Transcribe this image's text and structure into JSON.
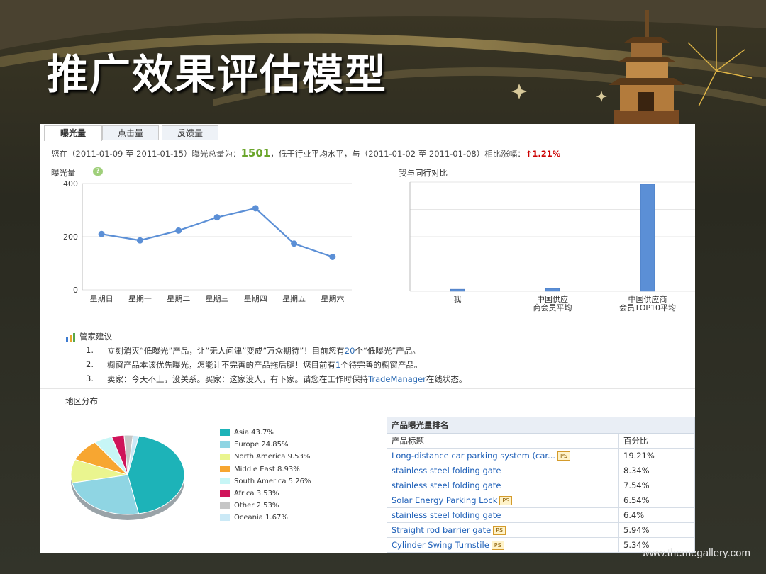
{
  "slide": {
    "title": "推广效果评估模型",
    "footer": "www.themegallery.com"
  },
  "tabs": [
    {
      "label": "曝光量",
      "active": true
    },
    {
      "label": "点击量",
      "active": false
    },
    {
      "label": "反馈量",
      "active": false
    }
  ],
  "summary": {
    "prefix": "您在（2011-01-09 至 2011-01-15）曝光总量为：",
    "total": "1501",
    "middle": "，低于行业平均水平，与（2011-01-02 至 2011-01-08）相比涨幅：",
    "change": "↑1.21%"
  },
  "exposure_chart": {
    "title": "曝光量",
    "help_icon": "?"
  },
  "compare_chart": {
    "title": "我与同行对比"
  },
  "chart_data": [
    {
      "type": "line",
      "title": "曝光量",
      "categories": [
        "星期日",
        "星期一",
        "星期二",
        "星期三",
        "星期四",
        "星期五",
        "星期六"
      ],
      "values": [
        210,
        186,
        223,
        273,
        307,
        174,
        124
      ],
      "ylim": [
        0,
        400
      ],
      "yticks": [
        "0",
        "200",
        "400"
      ],
      "color": "#5b8fd6",
      "grid": true
    },
    {
      "type": "bar",
      "title": "我与同行对比",
      "categories": [
        "我",
        "中国供应商会员平均",
        "中国供应商会员TOP10平均"
      ],
      "category_lines": [
        [
          "我"
        ],
        [
          "中国供应",
          "商会员平均"
        ],
        [
          "中国供应商",
          "会员TOP10平均"
        ]
      ],
      "values": [
        1501,
        2100,
        78500
      ],
      "ylim": [
        0,
        80000
      ],
      "color": "#5b8fd6",
      "grid": true
    },
    {
      "type": "pie",
      "title": "地区分布",
      "labels": [
        "Asia 43.7%",
        "Europe 24.85%",
        "North America 9.53%",
        "Middle East 8.93%",
        "South America 5.26%",
        "Africa 3.53%",
        "Other 2.53%",
        "Oceania 1.67%"
      ],
      "values": [
        43.7,
        24.85,
        9.53,
        8.93,
        5.26,
        3.53,
        2.53,
        1.67
      ],
      "colors": [
        "#1db3b8",
        "#8fd5e3",
        "#eaf58f",
        "#f7a631",
        "#c7f6f6",
        "#cf145a",
        "#c6c6c6",
        "#cbe9f6"
      ]
    }
  ],
  "advice": {
    "title": "管家建议",
    "items": [
      {
        "num": "1.",
        "pre": "立刻消灭“低曝光”产品，让“无人问津”变成“万众期待”！目前您有",
        "hl": "20",
        "post": "个“低曝光”产品。"
      },
      {
        "num": "2.",
        "pre": "橱窗产品本该优先曝光，怎能让不完善的产品拖后腿！您目前有",
        "hl": "1",
        "post": "个待完善的橱窗产品。"
      },
      {
        "num": "3.",
        "pre": "卖家：今天不上，没关系。买家：这家没人，有下家。请您在工作时保持",
        "hl": "TradeManager",
        "post": "在线状态。"
      }
    ]
  },
  "region": {
    "title": "地区分布"
  },
  "ranking": {
    "caption": "产品曝光量排名",
    "headers": [
      "产品标题",
      "百分比"
    ],
    "rows": [
      {
        "title": "Long-distance car parking system (car...",
        "ps": "PS",
        "pct": "19.21%"
      },
      {
        "title": "stainless steel folding gate",
        "ps": "",
        "pct": "8.34%"
      },
      {
        "title": "stainless steel folding gate",
        "ps": "",
        "pct": "7.54%"
      },
      {
        "title": "Solar Energy Parking Lock",
        "ps": "PS",
        "pct": "6.54%"
      },
      {
        "title": "stainless steel folding gate",
        "ps": "",
        "pct": "6.4%"
      },
      {
        "title": "Straight rod barrier gate",
        "ps": "PS",
        "pct": "5.94%"
      },
      {
        "title": "Cylinder Swing Turnstile",
        "ps": "PS",
        "pct": "5.34%"
      }
    ]
  }
}
